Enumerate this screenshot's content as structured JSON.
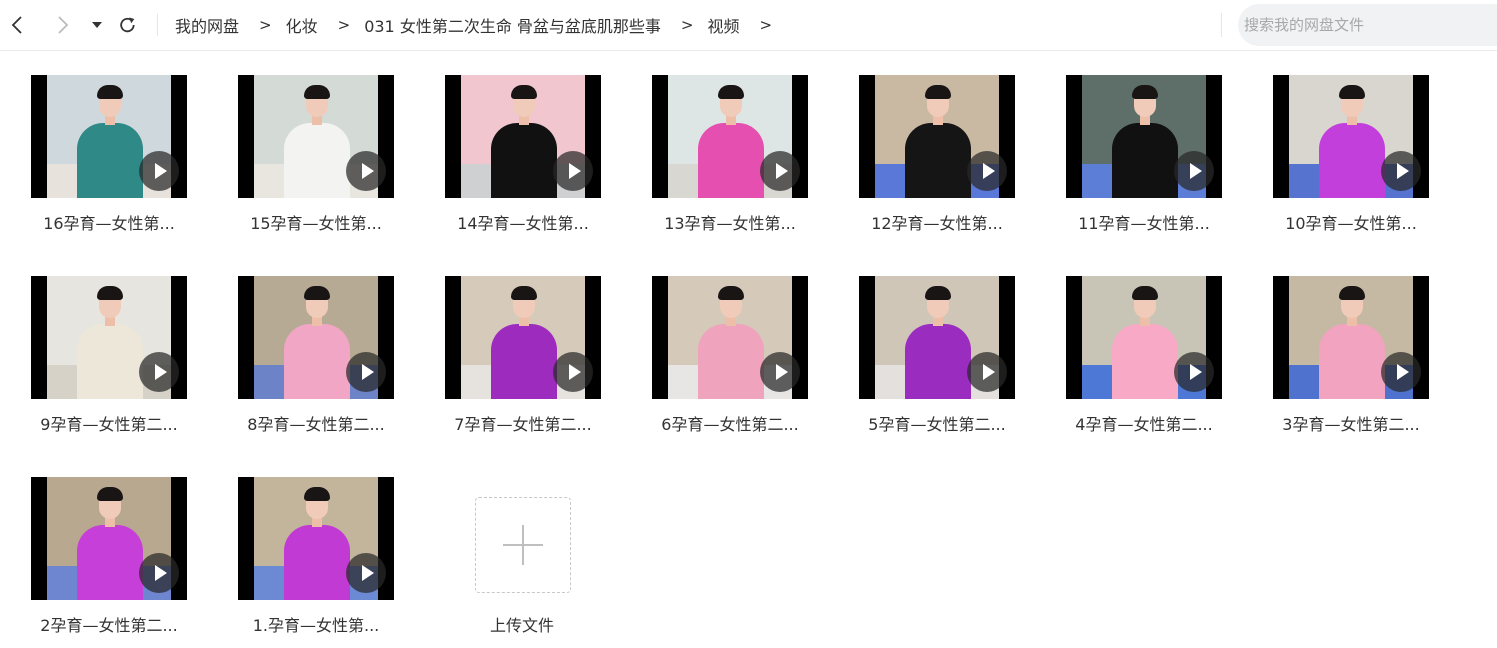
{
  "toolbar": {
    "back_icon": "chevron-left-icon",
    "forward_icon": "chevron-right-icon",
    "history_icon": "caret-down-icon",
    "refresh_icon": "refresh-icon"
  },
  "breadcrumb": [
    {
      "label": "我的网盘"
    },
    {
      "label": "化妆"
    },
    {
      "label": "031 女性第二次生命 骨盆与盆底肌那些事"
    },
    {
      "label": "视频"
    }
  ],
  "breadcrumb_separator": ">",
  "search": {
    "placeholder": "搜索我的网盘文件"
  },
  "files": [
    {
      "name": "16孕育—女性第...",
      "wall": "#cfd8dc",
      "floor": "#e7e3dc",
      "shirt": "#2f8a87"
    },
    {
      "name": "15孕育—女性第...",
      "wall": "#d4dbd6",
      "floor": "#e8e6df",
      "shirt": "#f3f3f1"
    },
    {
      "name": "14孕育—女性第...",
      "wall": "#f2c6cf",
      "floor": "#cfd0d2",
      "shirt": "#111111"
    },
    {
      "name": "13孕育—女性第...",
      "wall": "#dde6e4",
      "floor": "#d9d7d2",
      "shirt": "#e54fb0"
    },
    {
      "name": "12孕育—女性第...",
      "wall": "#c9b8a2",
      "floor": "#5a78d8",
      "shirt": "#151515"
    },
    {
      "name": "11孕育—女性第...",
      "wall": "#5d6f68",
      "floor": "#5d7ed6",
      "shirt": "#111111"
    },
    {
      "name": "10孕育—女性第...",
      "wall": "#d8d6cf",
      "floor": "#5673cf",
      "shirt": "#c23fdc"
    },
    {
      "name": "9孕育—女性第二...",
      "wall": "#e7e5df",
      "floor": "#d6d2c8",
      "shirt": "#ede7d9"
    },
    {
      "name": "8孕育—女性第二...",
      "wall": "#b7aa94",
      "floor": "#6c83c8",
      "shirt": "#f1a6c6"
    },
    {
      "name": "7孕育—女性第二...",
      "wall": "#d6cabb",
      "floor": "#e6e2de",
      "shirt": "#9d2bbd"
    },
    {
      "name": "6孕育—女性第二...",
      "wall": "#d5c9ba",
      "floor": "#e8e6e4",
      "shirt": "#f0a3bd"
    },
    {
      "name": "5孕育—女性第二...",
      "wall": "#cfc6b8",
      "floor": "#e3e0de",
      "shirt": "#9a2cc0"
    },
    {
      "name": "4孕育—女性第二...",
      "wall": "#c8c5b7",
      "floor": "#4d78d6",
      "shirt": "#f7a9c5"
    },
    {
      "name": "3孕育—女性第二...",
      "wall": "#c6b9a4",
      "floor": "#4f72cf",
      "shirt": "#f2a3bf"
    },
    {
      "name": "2孕育—女性第二...",
      "wall": "#b7a88f",
      "floor": "#6e86d0",
      "shirt": "#c53fd8"
    },
    {
      "name": "1.孕育—女性第...",
      "wall": "#c3b59c",
      "floor": "#6b8ad3",
      "shirt": "#c13ad3"
    }
  ],
  "upload": {
    "label": "上传文件",
    "icon": "plus-icon"
  }
}
